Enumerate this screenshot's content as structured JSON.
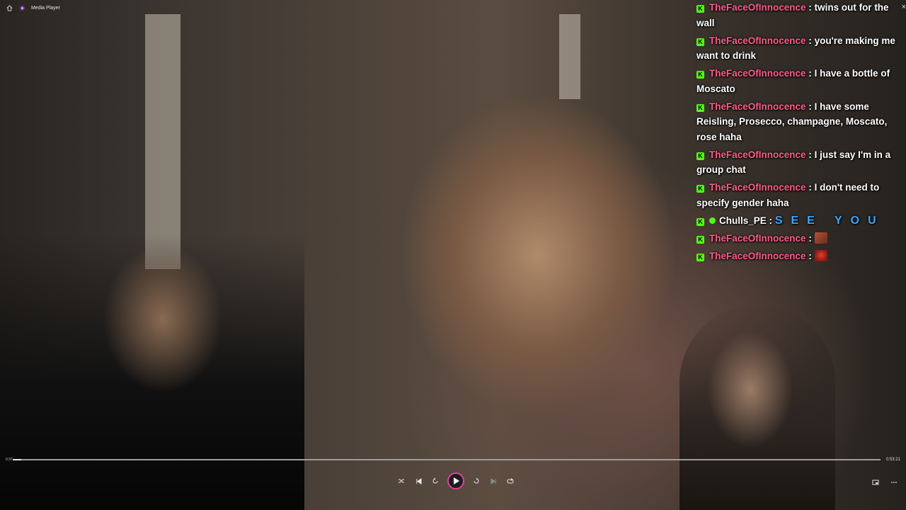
{
  "window": {
    "title": "Media Player",
    "close_label": "×"
  },
  "chat": {
    "messages": [
      {
        "user": "TheFaceOfInnocence",
        "text": "twins out for the wall"
      },
      {
        "user": "TheFaceOfInnocence",
        "text": "you're making me want to drink"
      },
      {
        "user": "TheFaceOfInnocence",
        "text": "I have a bottle of Moscato"
      },
      {
        "user": "TheFaceOfInnocence",
        "text": "I have some Reisling, Prosecco, champagne, Moscato, rose haha"
      },
      {
        "user": "TheFaceOfInnocence",
        "text": "I just say I'm in a group chat"
      },
      {
        "user": "TheFaceOfInnocence",
        "text": "I don't need to specify gender haha"
      },
      {
        "user": "Chulls_PE",
        "text": "SEE YOU"
      },
      {
        "user": "TheFaceOfInnocence",
        "text": ""
      },
      {
        "user": "TheFaceOfInnocence",
        "text": ""
      }
    ],
    "separator": ":"
  },
  "player": {
    "time_current": "0:37",
    "time_total": "0:53:21",
    "progress": 0.01,
    "colors": {
      "accent": "#e040a0",
      "username": "#ff5c8a",
      "kick_badge": "#53fc18"
    }
  }
}
